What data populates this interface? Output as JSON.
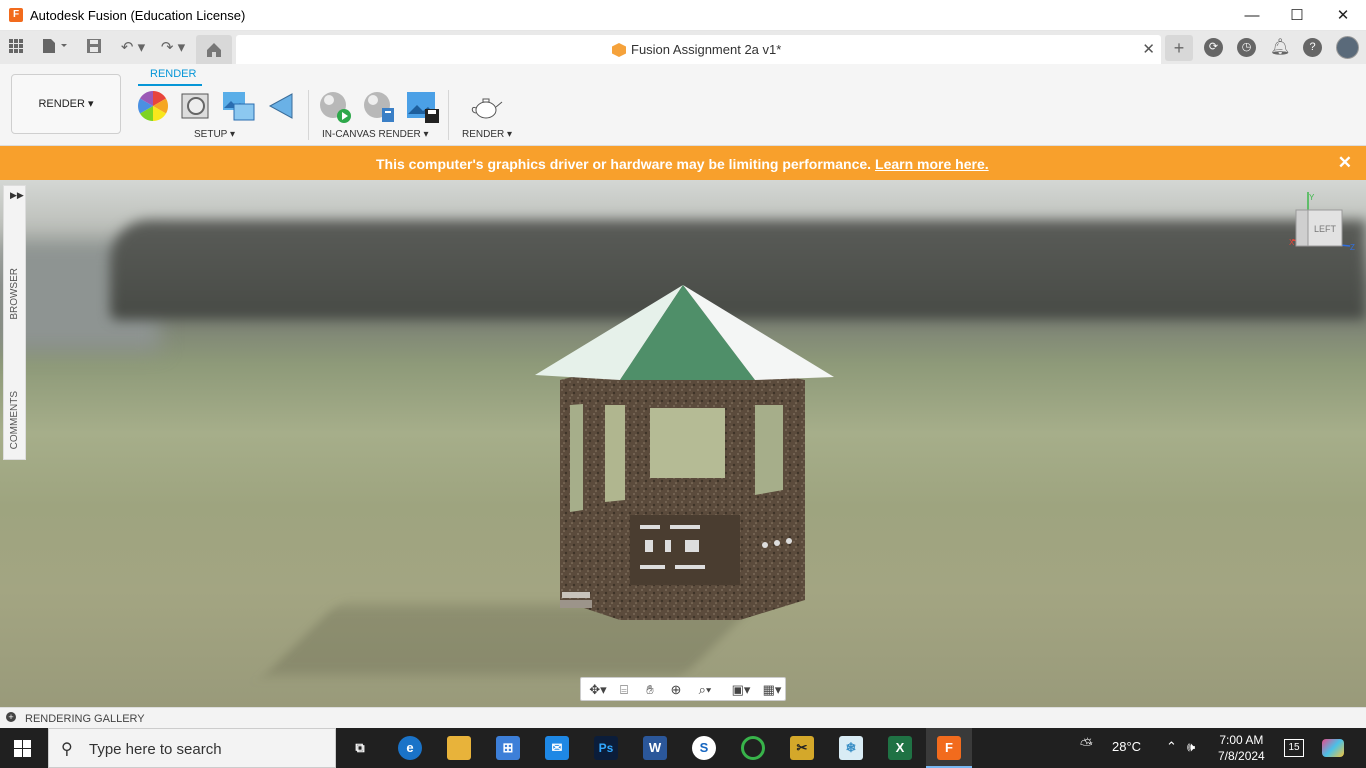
{
  "window": {
    "title": "Autodesk Fusion (Education License)",
    "minimize": "—",
    "maximize": "☐",
    "close": "✕"
  },
  "tabbar": {
    "document_tab": "Fusion Assignment 2a v1*",
    "close_tab": "✕",
    "new_tab": "+"
  },
  "ribbon": {
    "workspace": "RENDER",
    "active_tab": "RENDER",
    "groups": {
      "setup": "SETUP",
      "in_canvas_render": "IN-CANVAS RENDER",
      "render": "RENDER"
    }
  },
  "alert": {
    "message": "This computer's graphics driver or hardware may be limiting performance.",
    "link": "Learn more here.",
    "close": "✕"
  },
  "sidebar": {
    "browser": "BROWSER",
    "comments": "COMMENTS"
  },
  "viewcube": {
    "face": "LEFT",
    "axes": [
      "Y",
      "X",
      "Z"
    ]
  },
  "bottom_panel": {
    "label": "RENDERING GALLERY"
  },
  "taskbar": {
    "search_placeholder": "Type here to search",
    "weather": "28°C",
    "time": "7:00 AM",
    "date": "7/8/2024",
    "notifications": "15",
    "apps": [
      "task-view",
      "edge",
      "file-explorer",
      "microsoft-store",
      "mail",
      "photoshop",
      "word",
      "skype",
      "app-green-ring",
      "app-tools",
      "app-snowflake",
      "excel",
      "fusion"
    ]
  },
  "colors": {
    "accent_blue": "#0696d7",
    "alert_orange": "#f8a02c",
    "taskbar": "#202020",
    "roof_green": "#4f8f69",
    "stone_brown": "#5b4b3c"
  }
}
